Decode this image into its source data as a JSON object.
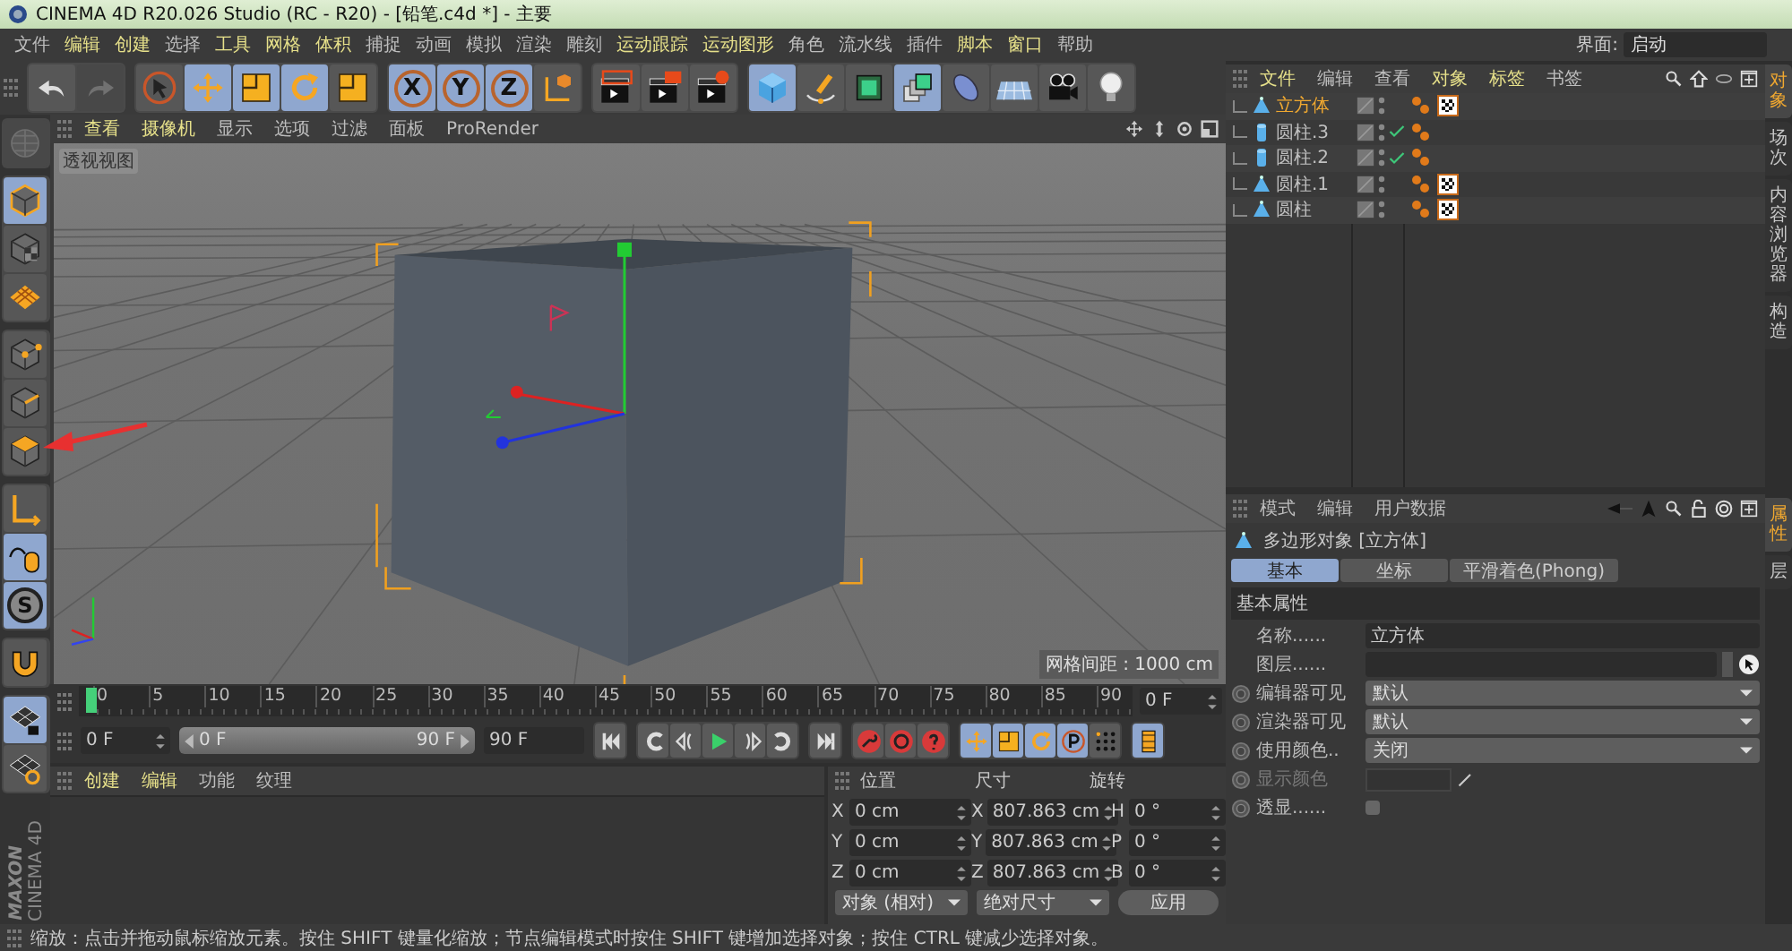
{
  "title_bar": {
    "title": "CINEMA 4D R20.026 Studio (RC - R20) - [铅笔.c4d *] - 主要"
  },
  "menu_bar": {
    "items": [
      {
        "label": "文件",
        "highlighted": false
      },
      {
        "label": "编辑",
        "highlighted": true
      },
      {
        "label": "创建",
        "highlighted": true
      },
      {
        "label": "选择",
        "highlighted": false
      },
      {
        "label": "工具",
        "highlighted": true
      },
      {
        "label": "网格",
        "highlighted": true
      },
      {
        "label": "体积",
        "highlighted": true
      },
      {
        "label": "捕捉",
        "highlighted": false
      },
      {
        "label": "动画",
        "highlighted": false
      },
      {
        "label": "模拟",
        "highlighted": false
      },
      {
        "label": "渲染",
        "highlighted": false
      },
      {
        "label": "雕刻",
        "highlighted": false
      },
      {
        "label": "运动跟踪",
        "highlighted": true
      },
      {
        "label": "运动图形",
        "highlighted": true
      },
      {
        "label": "角色",
        "highlighted": false
      },
      {
        "label": "流水线",
        "highlighted": false
      },
      {
        "label": "插件",
        "highlighted": false
      },
      {
        "label": "脚本",
        "highlighted": true
      },
      {
        "label": "窗口",
        "highlighted": true
      },
      {
        "label": "帮助",
        "highlighted": false
      }
    ],
    "layout_label": "界面:",
    "layout_value": "启动"
  },
  "toolbar": {
    "groups": [
      [
        {
          "selected": false,
          "disabled": false
        },
        {
          "selected": false,
          "disabled": true
        }
      ],
      [
        {
          "selected": false
        },
        {
          "selected": true
        },
        {
          "selected": true
        },
        {
          "selected": true
        },
        {
          "selected": false
        }
      ],
      [
        {
          "selected": true,
          "label": "X"
        },
        {
          "selected": true,
          "label": "Y"
        },
        {
          "selected": true,
          "label": "Z"
        },
        {
          "selected": false
        }
      ],
      [
        {
          "selected": false
        },
        {
          "selected": false
        },
        {
          "selected": false
        }
      ],
      [
        {
          "selected": true
        },
        {
          "selected": false
        },
        {
          "selected": false
        },
        {
          "selected": true
        },
        {
          "selected": false
        },
        {
          "selected": false
        },
        {
          "selected": false
        },
        {
          "selected": false
        }
      ]
    ]
  },
  "left_toolbar": {
    "buttons": [
      {
        "selected": false,
        "disabled": true
      },
      {
        "selected": true,
        "disabled": false
      },
      {
        "selected": false,
        "disabled": false
      },
      {
        "selected": false,
        "disabled": false
      },
      {
        "selected": false,
        "disabled": false
      },
      {
        "selected": false,
        "disabled": false
      },
      {
        "selected": false,
        "disabled": false
      },
      {
        "selected": false,
        "disabled": false
      },
      {
        "selected": true,
        "disabled": false
      },
      {
        "selected": true,
        "disabled": false,
        "label": "S"
      },
      {
        "selected": false,
        "disabled": false
      },
      {
        "selected": true,
        "disabled": false
      },
      {
        "selected": false,
        "disabled": false
      }
    ]
  },
  "viewport": {
    "menu": [
      {
        "label": "查看",
        "highlighted": true
      },
      {
        "label": "摄像机",
        "highlighted": true
      },
      {
        "label": "显示",
        "highlighted": false
      },
      {
        "label": "选项",
        "highlighted": false
      },
      {
        "label": "过滤",
        "highlighted": false
      },
      {
        "label": "面板",
        "highlighted": false
      },
      {
        "label": "ProRender",
        "highlighted": false
      }
    ],
    "view_label": "透视视图",
    "grid_info": "网格间距 : 1000 cm"
  },
  "timeline": {
    "ticks": [
      "0",
      "5",
      "10",
      "15",
      "20",
      "25",
      "30",
      "35",
      "40",
      "45",
      "50",
      "55",
      "60",
      "65",
      "70",
      "75",
      "80",
      "85",
      "90"
    ],
    "current_frame": "0 F"
  },
  "playback": {
    "start_field": "0 F",
    "range": {
      "start": "0 F",
      "end": "90 F",
      "level": 1
    },
    "end_field": "90 F",
    "key_buttons": [
      {
        "selected": true
      },
      {
        "selected": true
      },
      {
        "selected": true
      },
      {
        "selected": true
      },
      {
        "selected": false
      },
      {
        "selected": true
      }
    ]
  },
  "material_panel": {
    "menu": [
      {
        "label": "创建",
        "highlighted": true
      },
      {
        "label": "编辑",
        "highlighted": true
      },
      {
        "label": "功能",
        "highlighted": false
      },
      {
        "label": "纹理",
        "highlighted": false
      }
    ]
  },
  "coordinates": {
    "headers": [
      "位置",
      "尺寸",
      "旋转"
    ],
    "rows": [
      {
        "cells": [
          {
            "axis": "X",
            "value": "0 cm"
          },
          {
            "axis": "X",
            "value": "807.863 cm"
          },
          {
            "axis": "H",
            "value": "0 °"
          }
        ]
      },
      {
        "cells": [
          {
            "axis": "Y",
            "value": "0 cm"
          },
          {
            "axis": "Y",
            "value": "807.863 cm"
          },
          {
            "axis": "P",
            "value": "0 °"
          }
        ]
      },
      {
        "cells": [
          {
            "axis": "Z",
            "value": "0 cm"
          },
          {
            "axis": "Z",
            "value": "807.863 cm"
          },
          {
            "axis": "B",
            "value": "0 °"
          }
        ]
      }
    ],
    "mode_dropdown": "对象 (相对)",
    "size_dropdown": "绝对尺寸",
    "apply_button": "应用"
  },
  "object_manager": {
    "menu": [
      {
        "label": "文件",
        "highlighted": true
      },
      {
        "label": "编辑",
        "highlighted": false
      },
      {
        "label": "查看",
        "highlighted": false
      },
      {
        "label": "对象",
        "highlighted": true
      },
      {
        "label": "标签",
        "highlighted": true
      },
      {
        "label": "书签",
        "highlighted": false
      }
    ],
    "objects": [
      {
        "name": "立方体",
        "kind": "polygon",
        "selected": true,
        "checked": false,
        "tags": [
          {
            "kind": "phong"
          },
          {
            "kind": "texture"
          }
        ]
      },
      {
        "name": "圆柱.3",
        "kind": "cylinder",
        "selected": false,
        "checked": true,
        "tags": [
          {
            "kind": "phong"
          }
        ]
      },
      {
        "name": "圆柱.2",
        "kind": "cylinder",
        "selected": false,
        "checked": true,
        "tags": [
          {
            "kind": "phong"
          }
        ]
      },
      {
        "name": "圆柱.1",
        "kind": "polygon",
        "selected": false,
        "checked": false,
        "tags": [
          {
            "kind": "phong"
          },
          {
            "kind": "texture"
          }
        ]
      },
      {
        "name": "圆柱",
        "kind": "polygon",
        "selected": false,
        "checked": false,
        "tags": [
          {
            "kind": "phong"
          },
          {
            "kind": "texture"
          }
        ]
      }
    ]
  },
  "attribute_manager": {
    "menu": [
      {
        "label": "模式",
        "highlighted": false
      },
      {
        "label": "编辑",
        "highlighted": false
      },
      {
        "label": "用户数据",
        "highlighted": false
      }
    ],
    "object_title": "多边形对象 [立方体]",
    "tabs": [
      {
        "label": "基本",
        "selected": true
      },
      {
        "label": "坐标",
        "selected": false
      },
      {
        "label": "平滑着色(Phong)",
        "selected": false
      }
    ],
    "section": "基本属性",
    "fields": [
      {
        "kind": "text",
        "label": "名称......",
        "value": "立方体",
        "animatable": false,
        "disabled": false
      },
      {
        "kind": "link",
        "label": "图层......",
        "animatable": false,
        "disabled": false
      },
      {
        "kind": "dropdown",
        "label": "编辑器可见",
        "value": "默认",
        "animatable": true,
        "disabled": false
      },
      {
        "kind": "dropdown",
        "label": "渲染器可见",
        "value": "默认",
        "animatable": true,
        "disabled": false
      },
      {
        "kind": "dropdown",
        "label": "使用颜色..",
        "value": "关闭",
        "animatable": true,
        "disabled": false
      },
      {
        "kind": "color",
        "label": "显示颜色",
        "animatable": true,
        "disabled": true
      },
      {
        "kind": "checkbox",
        "label": "透显......",
        "checked": false,
        "animatable": true,
        "disabled": false
      }
    ]
  },
  "side_tabs": {
    "upper": [
      {
        "label": "对象",
        "selected": true
      },
      {
        "label": "场次",
        "selected": false
      },
      {
        "label": "内容浏览器",
        "selected": false
      },
      {
        "label": "构造",
        "selected": false
      }
    ],
    "lower": [
      {
        "label": "属性",
        "selected": true
      },
      {
        "label": "层",
        "selected": false
      }
    ]
  },
  "logo": {
    "brand": "MAXON",
    "product": "CINEMA 4D"
  },
  "status_bar": {
    "text": "缩放：点击并拖动鼠标缩放元素。按住 SHIFT 键量化缩放；节点编辑模式时按住 SHIFT 键增加选择对象；按住 CTRL 键减少选择对象。"
  }
}
